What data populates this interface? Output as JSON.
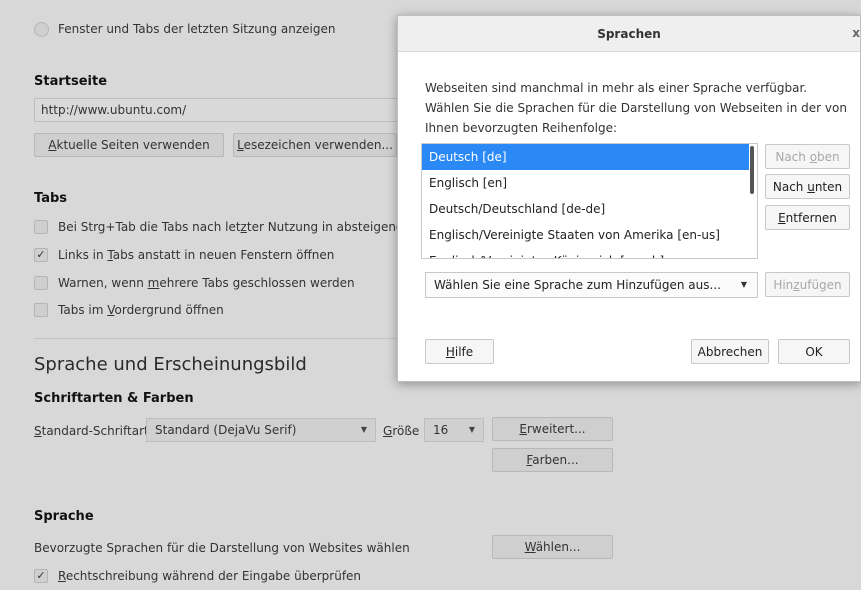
{
  "startup": {
    "restore_label": "Fenster und Tabs der letzten Sitzung anzeigen"
  },
  "homepage": {
    "heading": "Startseite",
    "url_value": "http://www.ubuntu.com/",
    "use_current_prefix": "",
    "use_current_accel": "A",
    "use_current_rest": "ktuelle Seiten verwenden",
    "use_bookmark_accel": "L",
    "use_bookmark_rest": "esezeichen verwenden..."
  },
  "tabs": {
    "heading": "Tabs",
    "items": [
      {
        "pre": "Bei Strg+Tab die Tabs nach let",
        "accel": "z",
        "post": "ter Nutzung in absteigender R",
        "checked": false
      },
      {
        "pre": "Links in ",
        "accel": "T",
        "post": "abs anstatt in neuen Fenstern öffnen",
        "checked": true
      },
      {
        "pre": "Warnen, wenn ",
        "accel": "m",
        "post": "ehrere Tabs geschlossen werden",
        "checked": false
      },
      {
        "pre": "Tabs im ",
        "accel": "V",
        "post": "ordergrund öffnen",
        "checked": false
      }
    ]
  },
  "appearance": {
    "heading": "Sprache und Erscheinungsbild",
    "fonts_heading": "Schriftarten & Farben",
    "std_font_accel": "S",
    "std_font_rest": "tandard-Schriftart",
    "font_value": "Standard (DejaVu Serif)",
    "size_accel": "G",
    "size_rest": "röße",
    "size_value": "16",
    "advanced_accel": "E",
    "advanced_rest": "rweitert...",
    "colors_accel": "F",
    "colors_rest": "arben..."
  },
  "language": {
    "heading": "Sprache",
    "pref_label": "Bevorzugte Sprachen für die Darstellung von Websites wählen",
    "choose_accel": "W",
    "choose_rest": "ählen...",
    "spell_accel": "R",
    "spell_rest": "echtschreibung während der Eingabe überprüfen",
    "spell_checked": true
  },
  "dialog": {
    "title": "Sprachen",
    "close": "x",
    "description": "Webseiten sind manchmal in mehr als einer Sprache verfügbar. Wählen Sie die Sprachen für die Darstellung von Webseiten in der von Ihnen bevorzugten Reihenfolge:",
    "languages": [
      "Deutsch  [de]",
      "Englisch  [en]",
      "Deutsch/Deutschland  [de-de]",
      "Englisch/Vereinigte Staaten von Amerika  [en-us]",
      "Englisch/Vereinigtes Königreich  [en-gb]"
    ],
    "selected_index": 0,
    "move_up_pre": "Nach ",
    "move_up_accel": "o",
    "move_up_post": "ben",
    "move_down_pre": "Nach ",
    "move_down_accel": "u",
    "move_down_post": "nten",
    "remove_accel": "E",
    "remove_rest": "ntfernen",
    "add_select": "Wählen Sie eine Sprache zum Hinzufügen aus...",
    "add_pre": "Hin",
    "add_accel": "z",
    "add_post": "ufügen",
    "help_accel": "H",
    "help_rest": "ilfe",
    "cancel": "Abbrechen",
    "ok": "OK"
  },
  "colors": {
    "selection": "#2a89f5",
    "background": "#d8d8d8",
    "dialog_bg": "#ffffff"
  }
}
